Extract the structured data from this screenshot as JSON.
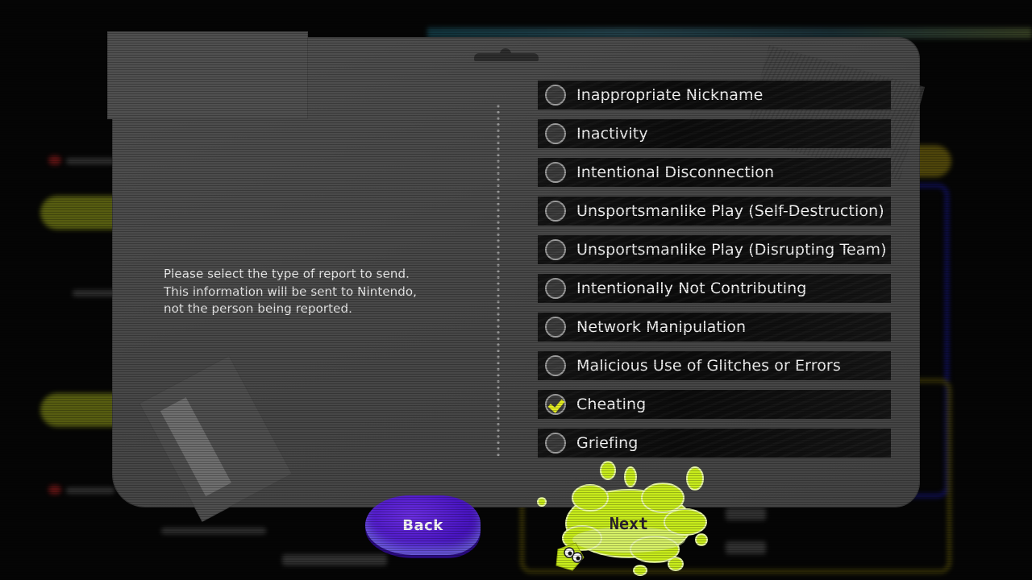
{
  "dialog": {
    "instructions": [
      "Please select the type of report to send.",
      "This information will be sent to Nintendo,",
      "not the person being reported."
    ],
    "options": [
      {
        "label": "Inappropriate Nickname",
        "selected": false
      },
      {
        "label": "Inactivity",
        "selected": false
      },
      {
        "label": "Intentional Disconnection",
        "selected": false
      },
      {
        "label": "Unsportsmanlike Play (Self-Destruction)",
        "selected": false
      },
      {
        "label": "Unsportsmanlike Play (Disrupting Team)",
        "selected": false
      },
      {
        "label": "Intentionally Not Contributing",
        "selected": false
      },
      {
        "label": "Network Manipulation",
        "selected": false
      },
      {
        "label": "Malicious Use of Glitches or Errors",
        "selected": false
      },
      {
        "label": "Cheating",
        "selected": true
      },
      {
        "label": "Griefing",
        "selected": false
      }
    ],
    "selected_option": "Cheating"
  },
  "buttons": {
    "back_label": "Back",
    "next_label": "Next"
  },
  "colors": {
    "checkmark": "#e5ef1f",
    "back_button": "#4b16c4",
    "next_button": "#c8ec1c",
    "panel": "#4a4a4a",
    "option_row": "#111111"
  },
  "icons": {
    "radio_unchecked": "radio-circle-icon",
    "radio_checked": "checkmark-icon",
    "squid": "squid-icon"
  }
}
